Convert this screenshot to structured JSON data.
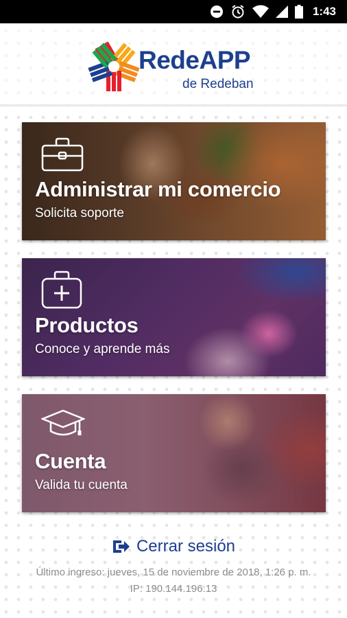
{
  "status_bar": {
    "time": "1:43",
    "icons": [
      "do-not-disturb-icon",
      "alarm-icon",
      "wifi-icon",
      "signal-icon",
      "battery-icon"
    ]
  },
  "header": {
    "logo_title": "RedeAPP",
    "logo_subtitle": "de Redeban",
    "brand_color": "#1d3f8f"
  },
  "cards": [
    {
      "title": "Administrar mi comercio",
      "subtitle": "Solicita soporte",
      "icon": "briefcase-icon"
    },
    {
      "title": "Productos",
      "subtitle": "Conoce y aprende más",
      "icon": "first-aid-kit-icon"
    },
    {
      "title": "Cuenta",
      "subtitle": "Valida tu cuenta",
      "icon": "graduation-cap-icon"
    }
  ],
  "logout": {
    "label": "Cerrar sesión",
    "icon": "logout-icon"
  },
  "last_login": {
    "line1": "Último ingreso: jueves, 15 de noviembre de 2018, 1:26 p. m.",
    "line2": "IP: 190.144.196.13"
  }
}
